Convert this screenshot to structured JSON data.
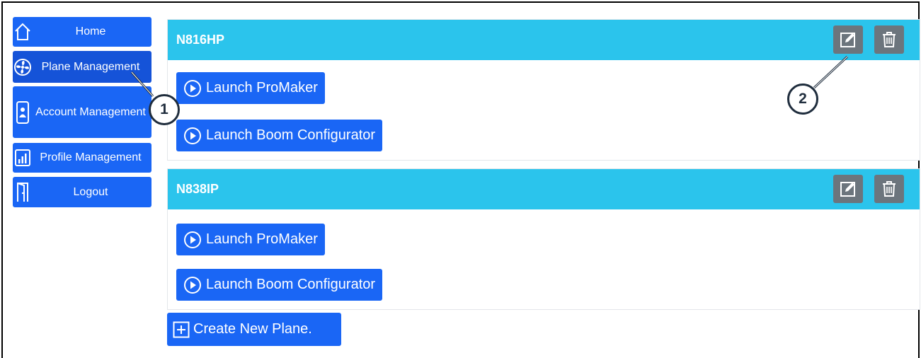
{
  "sidebar": {
    "items": [
      {
        "label": "Home",
        "icon": "home-icon"
      },
      {
        "label": "Plane Management",
        "icon": "fan-icon"
      },
      {
        "label": "Account Management",
        "icon": "phone-user-icon"
      },
      {
        "label": "Profile Management",
        "icon": "chart-icon"
      },
      {
        "label": "Logout",
        "icon": "door-icon"
      }
    ]
  },
  "planes": [
    {
      "name": "N816HP",
      "launch_promaker": "Launch ProMaker",
      "launch_boom": "Launch Boom Configurator"
    },
    {
      "name": "N838IP",
      "launch_promaker": "Launch ProMaker",
      "launch_boom": "Launch Boom Configurator"
    }
  ],
  "create_button": "Create New Plane.",
  "callouts": [
    "1",
    "2"
  ],
  "colors": {
    "primary": "#1a66f5",
    "header": "#2bc4ec",
    "icon_button": "#6c757d"
  }
}
